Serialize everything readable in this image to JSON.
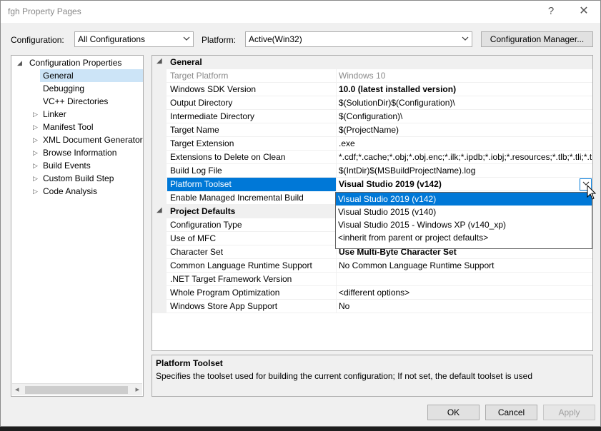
{
  "window": {
    "title": "fgh Property Pages",
    "help_glyph": "?",
    "close_glyph": "✕"
  },
  "toolbar": {
    "configuration_label": "Configuration:",
    "configuration_value": "All Configurations",
    "platform_label": "Platform:",
    "platform_value": "Active(Win32)",
    "config_manager_label": "Configuration Manager..."
  },
  "tree": {
    "items": [
      {
        "label": "Configuration Properties",
        "expander": "◢"
      },
      {
        "label": "General"
      },
      {
        "label": "Debugging"
      },
      {
        "label": "VC++ Directories"
      },
      {
        "label": "Linker",
        "expander": "▷"
      },
      {
        "label": "Manifest Tool",
        "expander": "▷"
      },
      {
        "label": "XML Document Generator",
        "expander": "▷"
      },
      {
        "label": "Browse Information",
        "expander": "▷"
      },
      {
        "label": "Build Events",
        "expander": "▷"
      },
      {
        "label": "Custom Build Step",
        "expander": "▷"
      },
      {
        "label": "Code Analysis",
        "expander": "▷"
      }
    ],
    "selected": "General"
  },
  "grid": {
    "categories": [
      {
        "label": "General",
        "expander": "◢"
      },
      {
        "label": "Project Defaults",
        "expander": "◢"
      }
    ],
    "rows": [
      {
        "name": "Target Platform",
        "value": "Windows 10"
      },
      {
        "name": "Windows SDK Version",
        "value": "10.0 (latest installed version)"
      },
      {
        "name": "Output Directory",
        "value": "$(SolutionDir)$(Configuration)\\"
      },
      {
        "name": "Intermediate Directory",
        "value": "$(Configuration)\\"
      },
      {
        "name": "Target Name",
        "value": "$(ProjectName)"
      },
      {
        "name": "Target Extension",
        "value": ".exe"
      },
      {
        "name": "Extensions to Delete on Clean",
        "value": "*.cdf;*.cache;*.obj;*.obj.enc;*.ilk;*.ipdb;*.iobj;*.resources;*.tlb;*.tli;*.t"
      },
      {
        "name": "Build Log File",
        "value": "$(IntDir)$(MSBuildProjectName).log"
      },
      {
        "name": "Platform Toolset",
        "value": "Visual Studio 2019 (v142)"
      },
      {
        "name": "Enable Managed Incremental Build",
        "value": ""
      },
      {
        "name": "Configuration Type",
        "value": ""
      },
      {
        "name": "Use of MFC",
        "value": ""
      },
      {
        "name": "Character Set",
        "value": "Use Multi-Byte Character Set"
      },
      {
        "name": "Common Language Runtime Support",
        "value": "No Common Language Runtime Support"
      },
      {
        "name": ".NET Target Framework Version",
        "value": ""
      },
      {
        "name": "Whole Program Optimization",
        "value": "<different options>"
      },
      {
        "name": "Windows Store App Support",
        "value": "No"
      }
    ],
    "dropdown_arrow": "⌄"
  },
  "dropdown": {
    "options": [
      "Visual Studio 2019 (v142)",
      "Visual Studio 2015 (v140)",
      "Visual Studio 2015 - Windows XP (v140_xp)",
      "<inherit from parent or project defaults>"
    ],
    "highlighted": "Visual Studio 2019 (v142)"
  },
  "description": {
    "title": "Platform Toolset",
    "text": "Specifies the toolset used for building the current configuration; If not set, the default toolset is used"
  },
  "buttons": {
    "ok": "OK",
    "cancel": "Cancel",
    "apply": "Apply"
  },
  "icons": {
    "combo_arrow": "chevron-down-icon",
    "scroll_left": "◂",
    "scroll_right": "▸"
  }
}
